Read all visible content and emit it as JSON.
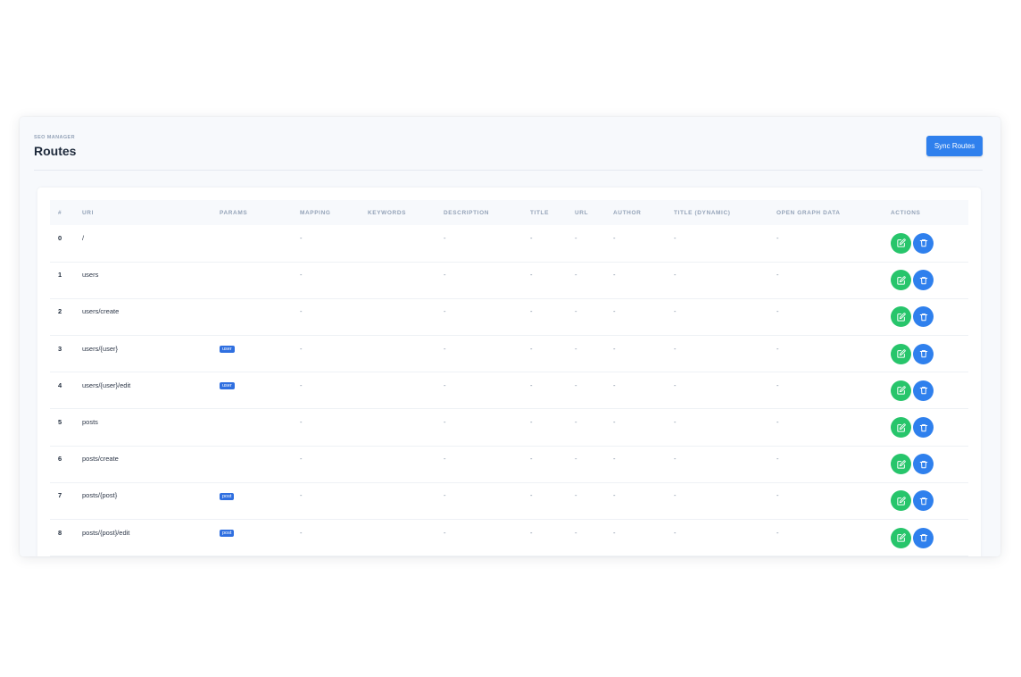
{
  "header": {
    "eyebrow": "SEO MANAGER",
    "title": "Routes",
    "sync_button": "Sync Routes"
  },
  "table": {
    "columns": [
      "#",
      "URI",
      "PARAMS",
      "MAPPING",
      "KEYWORDS",
      "DESCRIPTION",
      "TITLE",
      "URL",
      "AUTHOR",
      "TITLE (DYNAMIC)",
      "OPEN GRAPH DATA",
      "ACTIONS"
    ],
    "rows": [
      {
        "num": "0",
        "uri": "/",
        "param": "",
        "mapping": "-",
        "keywords": "",
        "description": "-",
        "title": "-",
        "url": "-",
        "author": "-",
        "title_dynamic": "-",
        "og": "-"
      },
      {
        "num": "1",
        "uri": "users",
        "param": "",
        "mapping": "-",
        "keywords": "",
        "description": "-",
        "title": "-",
        "url": "-",
        "author": "-",
        "title_dynamic": "-",
        "og": "-"
      },
      {
        "num": "2",
        "uri": "users/create",
        "param": "",
        "mapping": "-",
        "keywords": "",
        "description": "-",
        "title": "-",
        "url": "-",
        "author": "-",
        "title_dynamic": "-",
        "og": "-"
      },
      {
        "num": "3",
        "uri": "users/{user}",
        "param": "user",
        "mapping": "-",
        "keywords": "",
        "description": "-",
        "title": "-",
        "url": "-",
        "author": "-",
        "title_dynamic": "-",
        "og": "-"
      },
      {
        "num": "4",
        "uri": "users/{user}/edit",
        "param": "user",
        "mapping": "-",
        "keywords": "",
        "description": "-",
        "title": "-",
        "url": "-",
        "author": "-",
        "title_dynamic": "-",
        "og": "-"
      },
      {
        "num": "5",
        "uri": "posts",
        "param": "",
        "mapping": "-",
        "keywords": "",
        "description": "-",
        "title": "-",
        "url": "-",
        "author": "-",
        "title_dynamic": "-",
        "og": "-"
      },
      {
        "num": "6",
        "uri": "posts/create",
        "param": "",
        "mapping": "-",
        "keywords": "",
        "description": "-",
        "title": "-",
        "url": "-",
        "author": "-",
        "title_dynamic": "-",
        "og": "-"
      },
      {
        "num": "7",
        "uri": "posts/{post}",
        "param": "post",
        "mapping": "-",
        "keywords": "",
        "description": "-",
        "title": "-",
        "url": "-",
        "author": "-",
        "title_dynamic": "-",
        "og": "-"
      },
      {
        "num": "8",
        "uri": "posts/{post}/edit",
        "param": "post",
        "mapping": "-",
        "keywords": "",
        "description": "-",
        "title": "-",
        "url": "-",
        "author": "-",
        "title_dynamic": "-",
        "og": "-"
      }
    ]
  },
  "icons": {
    "edit": "edit-icon",
    "delete": "trash-icon"
  },
  "colors": {
    "primary": "#2f80ed",
    "success": "#27c56b",
    "badge": "#2f6fe0"
  }
}
